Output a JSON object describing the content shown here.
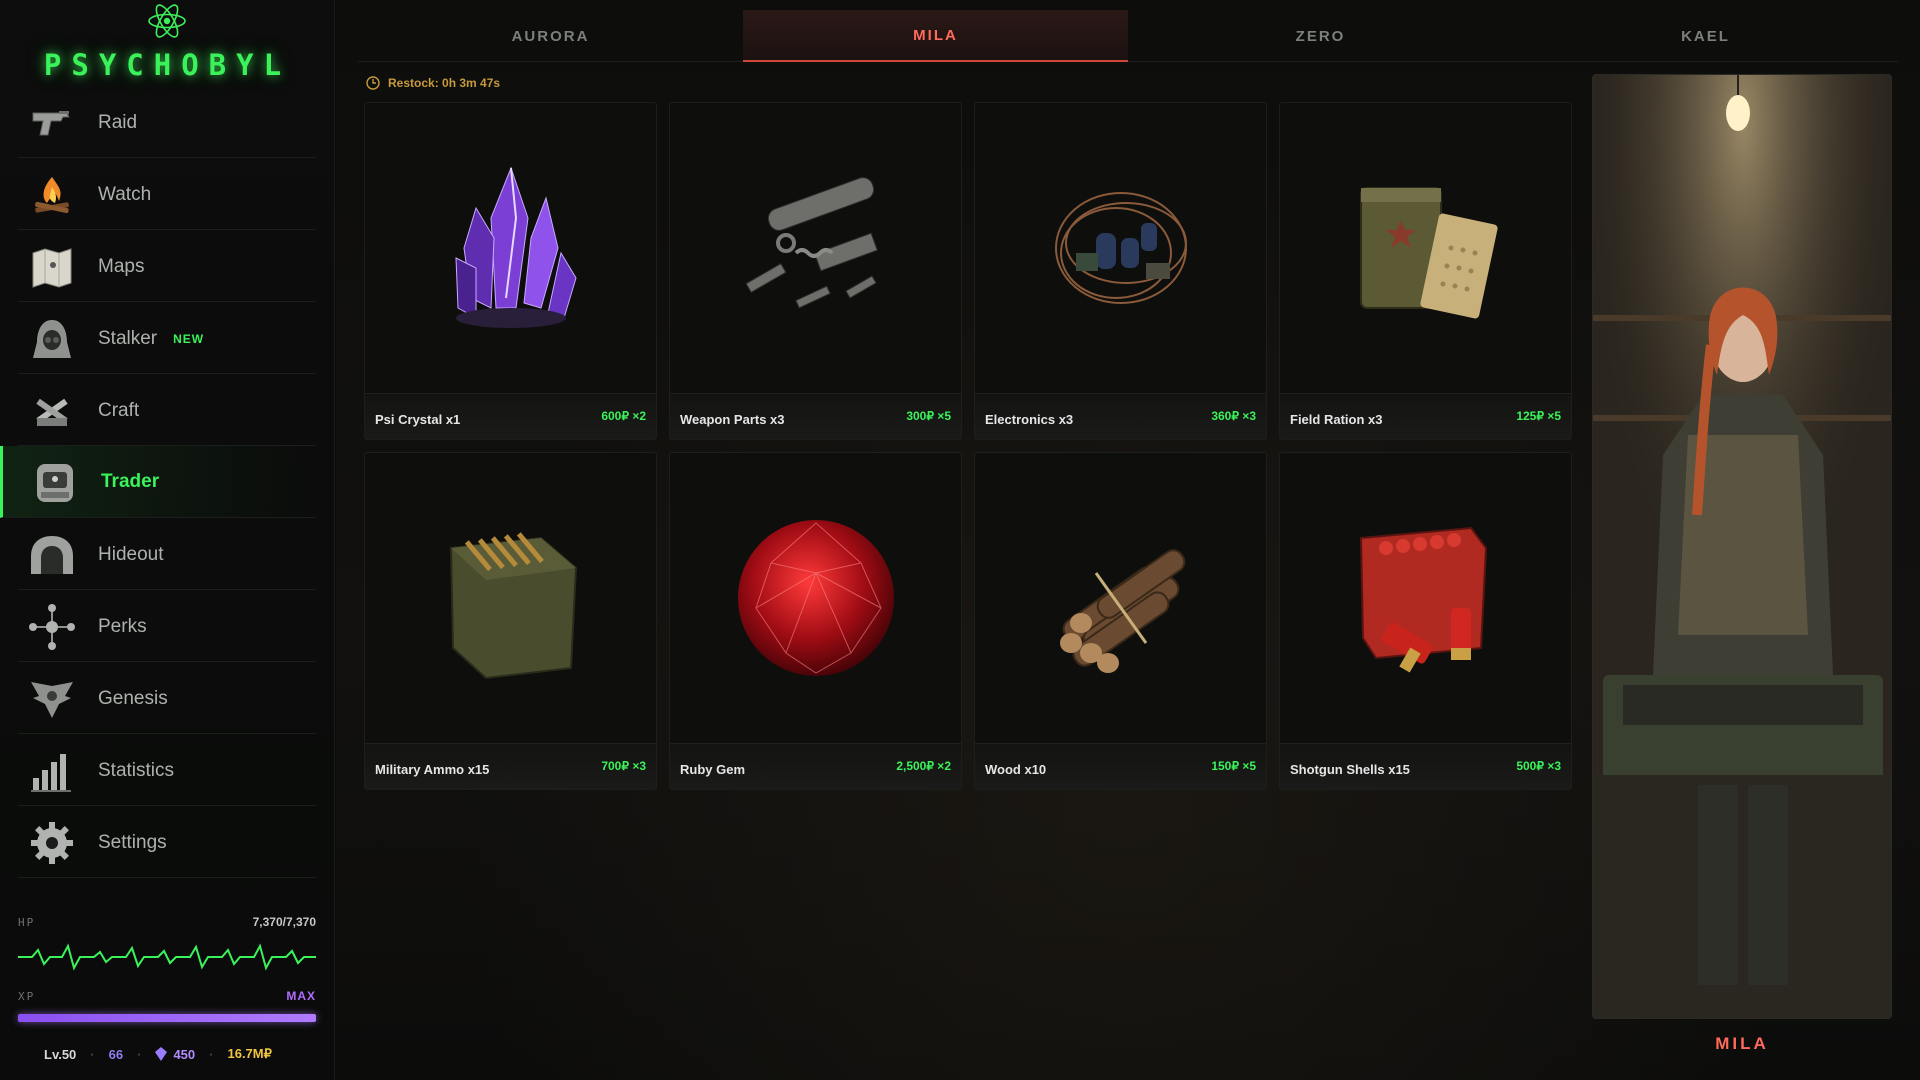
{
  "app": {
    "title": "PSYCHOBYL"
  },
  "sidebar": {
    "items": [
      {
        "label": "Raid",
        "icon": "pistol-icon"
      },
      {
        "label": "Watch",
        "icon": "campfire-icon"
      },
      {
        "label": "Maps",
        "icon": "map-icon"
      },
      {
        "label": "Stalker",
        "icon": "stalker-hood-icon",
        "badge": "NEW"
      },
      {
        "label": "Craft",
        "icon": "crafting-tools-icon"
      },
      {
        "label": "Trader",
        "icon": "trader-booth-icon",
        "active": true
      },
      {
        "label": "Hideout",
        "icon": "bunker-icon"
      },
      {
        "label": "Perks",
        "icon": "perk-tree-icon"
      },
      {
        "label": "Genesis",
        "icon": "winged-emblem-icon"
      },
      {
        "label": "Statistics",
        "icon": "bar-chart-icon"
      },
      {
        "label": "Settings",
        "icon": "gear-icon"
      }
    ]
  },
  "stats": {
    "hp_label": "HP",
    "hp_value": "7,370/7,370",
    "hp_fraction": 1.0,
    "xp_label": "XP",
    "xp_status": "MAX",
    "xp_fraction": 1.0,
    "level": "Lv.50",
    "gems": "66",
    "crystals": "450",
    "money": "16.7M₽"
  },
  "tabs": [
    {
      "label": "AURORA"
    },
    {
      "label": "MILA",
      "active": true
    },
    {
      "label": "ZERO"
    },
    {
      "label": "KAEL"
    }
  ],
  "restock": {
    "text": "Restock: 0h 3m 47s"
  },
  "items": [
    {
      "name": "Psi Crystal x1",
      "price": "600₽ ×2",
      "icon": "psi-crystal-icon"
    },
    {
      "name": "Weapon Parts x3",
      "price": "300₽ ×5",
      "icon": "weapon-parts-icon"
    },
    {
      "name": "Electronics x3",
      "price": "360₽ ×3",
      "icon": "electronics-icon"
    },
    {
      "name": "Field Ration x3",
      "price": "125₽ ×5",
      "icon": "field-ration-icon"
    },
    {
      "name": "Military Ammo x15",
      "price": "700₽ ×3",
      "icon": "ammo-box-icon"
    },
    {
      "name": "Ruby Gem",
      "price": "2,500₽ ×2",
      "icon": "ruby-gem-icon"
    },
    {
      "name": "Wood x10",
      "price": "150₽ ×5",
      "icon": "wood-bundle-icon"
    },
    {
      "name": "Shotgun Shells x15",
      "price": "500₽ ×3",
      "icon": "shotgun-shells-icon"
    }
  ],
  "trader": {
    "name": "MILA"
  },
  "colors": {
    "accent_green": "#3cf25a",
    "accent_red": "#ff6a5a",
    "xp_purple": "#b07bff",
    "money_gold": "#f0c640",
    "restock_amber": "#c79a3a"
  }
}
